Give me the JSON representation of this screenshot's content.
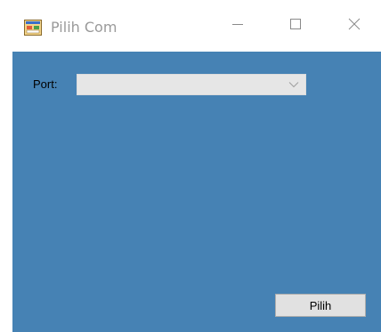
{
  "window": {
    "title": "Pilih Com",
    "icons": {
      "app": "app-form-icon",
      "minimize": "minimize-icon",
      "maximize": "maximize-icon",
      "close": "close-icon"
    }
  },
  "form": {
    "port_label": "Port:",
    "port_value": "",
    "pilih_button": "Pilih"
  },
  "colors": {
    "client_background": "#4682b4",
    "titlebar_background": "#ffffff",
    "combo_background": "#e6e6e6",
    "button_background": "#e1e1e1"
  }
}
